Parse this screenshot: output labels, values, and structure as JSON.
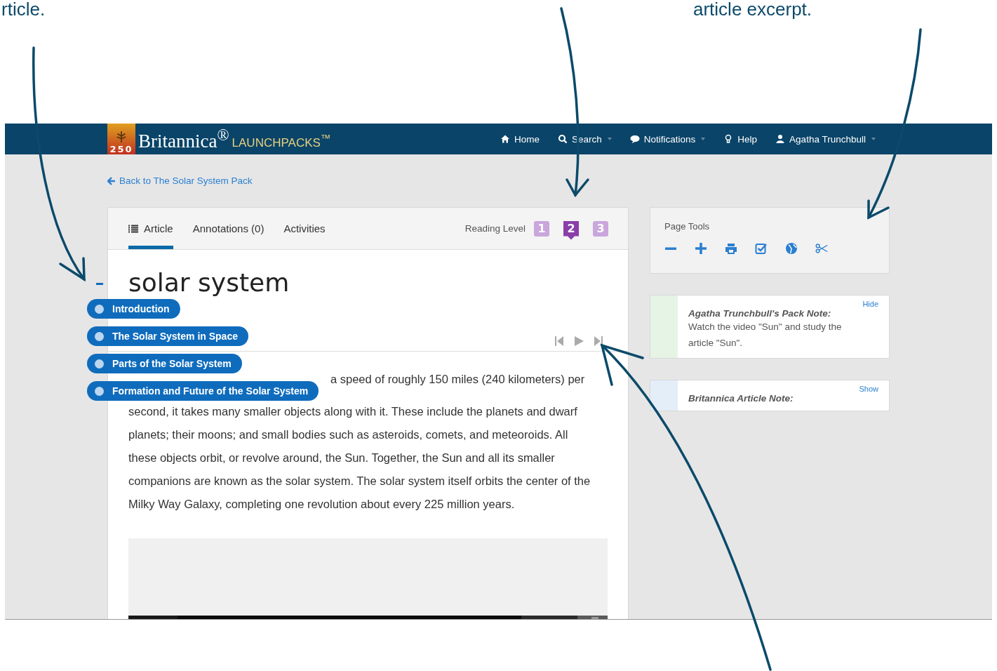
{
  "annotations": [
    "rticle.",
    "article excerpt."
  ],
  "navbar": {
    "logo_badge": "250",
    "brand": "Britannica$^{®}$",
    "product": "LAUNCHPACKS$^{™}$",
    "items": [
      {
        "label": "Home",
        "kind": "home",
        "dropdown": false
      },
      {
        "label": "Search",
        "kind": "search",
        "dropdown": true
      },
      {
        "label": "Notifications",
        "kind": "comment",
        "dropdown": true
      },
      {
        "label": "Help",
        "kind": "bulb",
        "dropdown": false
      },
      {
        "label": "Agatha Trunchbull",
        "kind": "user",
        "dropdown": true
      }
    ]
  },
  "back_link": "Back to The Solar System Pack",
  "article": {
    "tabs": [
      {
        "label": "Article",
        "selected": true,
        "kind": "list"
      },
      {
        "label": "Annotations (0)",
        "selected": false,
        "kind": "plain"
      },
      {
        "label": "Activities",
        "selected": false,
        "kind": "plain"
      }
    ],
    "reading_level": {
      "label": "Reading Level",
      "levels": [
        {
          "label": "1",
          "selected": false
        },
        {
          "label": "2",
          "selected": true
        },
        {
          "label": "3",
          "selected": false
        }
      ]
    },
    "title": "solar system",
    "toc": [
      "Introduction",
      "The Solar System in Space",
      "Parts of the Solar System",
      "Formation and Future of the Solar System"
    ],
    "first_line_fragment": "a speed of roughly 150 miles (240 kilometers) per",
    "body": "second, it takes many smaller objects along with it. These include the planets and dwarf planets; their moons; and small bodies such as asteroids, comets, and meteoroids. All these objects orbit, or revolve around, the Sun. Together, the Sun and all its smaller companions are known as the solar system. The solar system itself orbits the center of the Milky Way Galaxy, completing one revolution about every 225 million years.",
    "media": {
      "kind": "picture"
    }
  },
  "page_tools": {
    "title": "Page Tools",
    "tools": [
      {
        "kind": "minus"
      },
      {
        "kind": "plus"
      },
      {
        "kind": "print"
      },
      {
        "kind": "check"
      },
      {
        "kind": "globe"
      },
      {
        "kind": "scissors"
      }
    ]
  },
  "notes": [
    {
      "title": "Agatha Trunchbull's Pack Note:",
      "body": "Watch the video \"Sun\" and study the article \"Sun\".",
      "toggle": "Hide",
      "color": "#e6f4e6"
    },
    {
      "title": "Britannica Article Note:",
      "toggle": "Show",
      "color": "#e3eef9"
    }
  ]
}
